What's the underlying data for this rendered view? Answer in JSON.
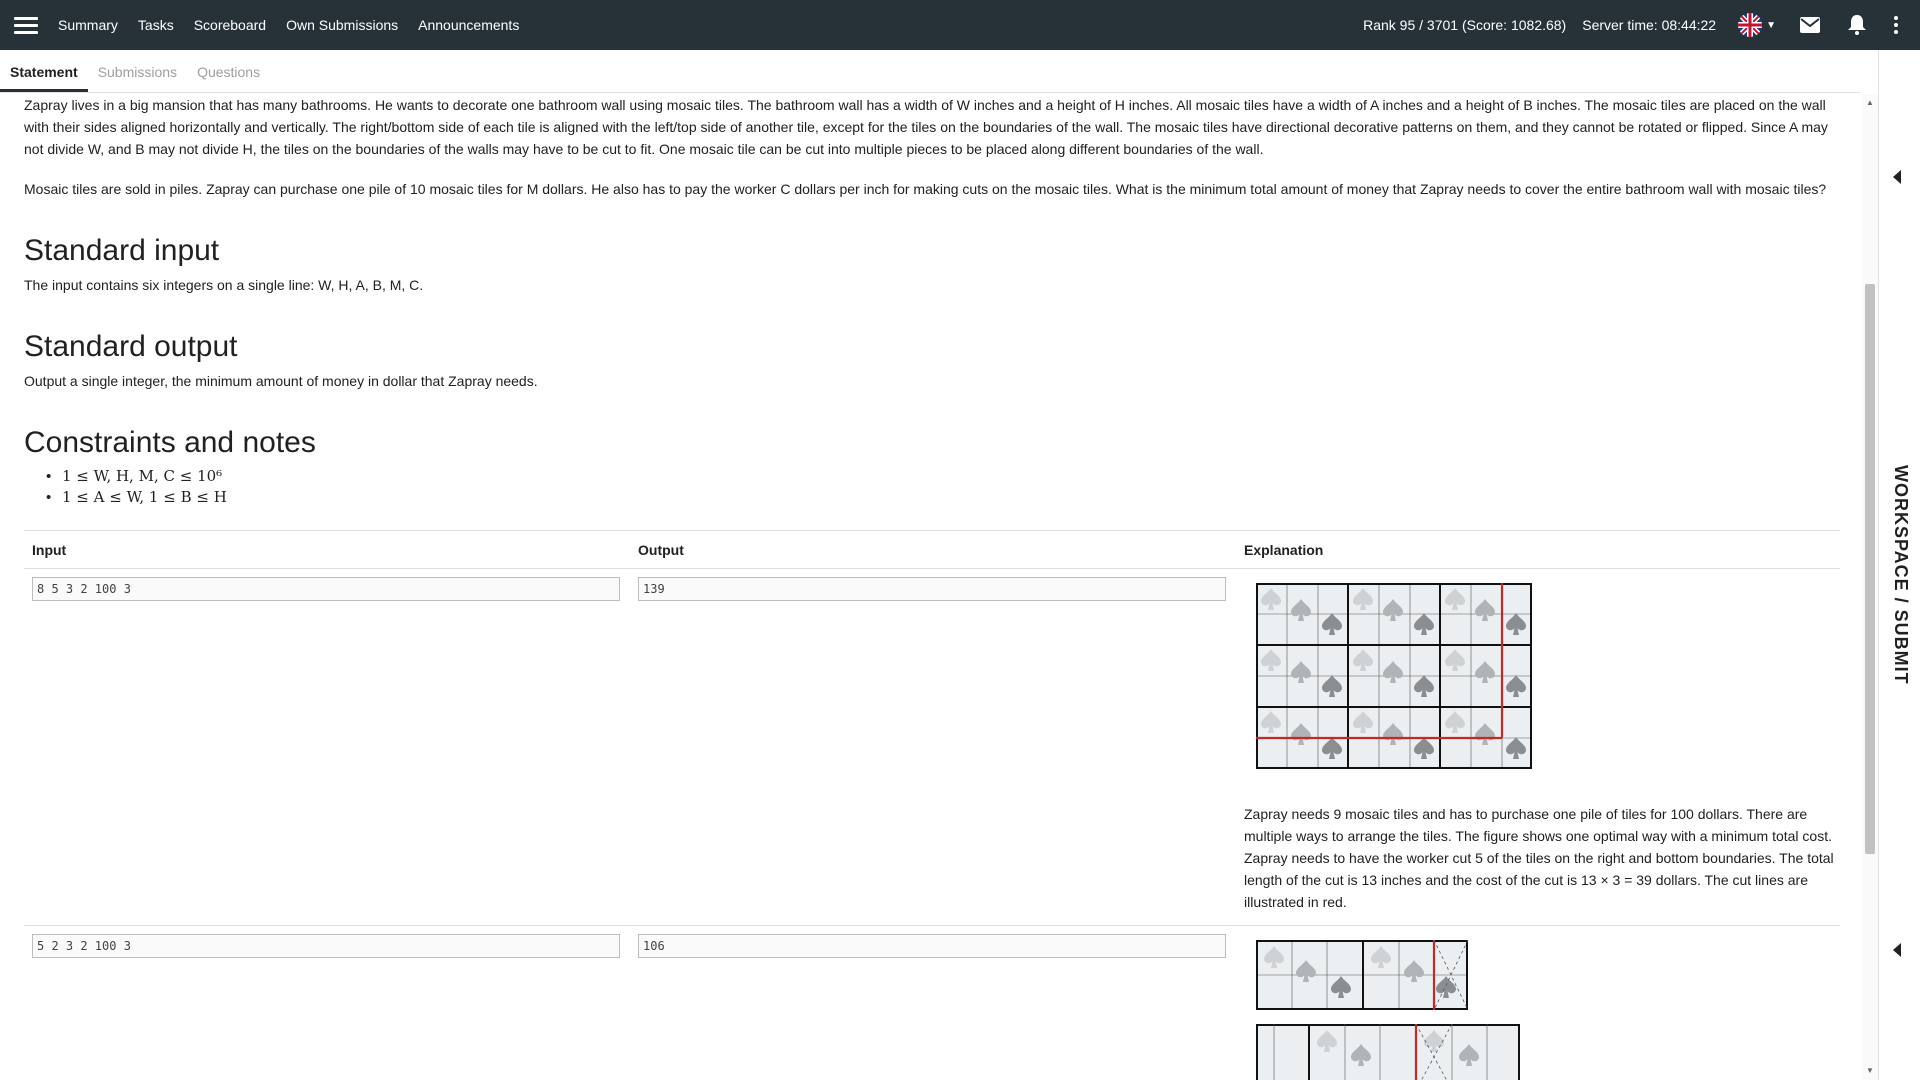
{
  "navbar": {
    "links": [
      "Summary",
      "Tasks",
      "Scoreboard",
      "Own Submissions",
      "Announcements"
    ],
    "rank": "Rank 95 / 3701 (Score: 1082.68)",
    "server_time": "Server time: 08:44:22",
    "icons": [
      "menu-icon",
      "uk-flag-icon",
      "envelope-icon",
      "bell-icon",
      "more-vert-icon"
    ]
  },
  "tabs": [
    "Statement",
    "Submissions",
    "Questions"
  ],
  "statement": {
    "intro": "Zapray lives in a big mansion that has many bathrooms. He wants to decorate one bathroom wall using mosaic tiles. The bathroom wall has a width of W inches and a height of H inches. All mosaic tiles have a width of A inches and a height of B inches. The mosaic tiles are placed on the wall with their sides aligned horizontally and vertically. The right/bottom side of each tile is aligned with the left/top side of another tile, except for the tiles on the boundaries of the wall. The mosaic tiles have directional decorative patterns on them, and they cannot be rotated or flipped. Since A may not divide W, and B may not divide H, the tiles on the boundaries of the walls may have to be cut to fit. One mosaic tile can be cut into multiple pieces to be placed along different boundaries of the wall.",
    "piles": "Mosaic tiles are sold in piles. Zapray can purchase one pile of 10 mosaic tiles for M dollars. He also has to pay the worker C dollars per inch for making cuts on the mosaic tiles. What is the minimum total amount of money that Zapray needs to cover the entire bathroom wall with mosaic tiles?",
    "input_heading": "Standard input",
    "input_text": "The input contains six integers on a single line: W, H, A, B, M, C.",
    "output_heading": "Standard output",
    "output_text": "Output a single integer, the minimum amount of money in dollar that Zapray needs.",
    "constraints_heading": "Constraints and notes",
    "constraints": [
      "1 ≤ W, H, M, C ≤ 10⁶",
      "1 ≤ A ≤ W, 1 ≤ B ≤ H"
    ]
  },
  "examples": {
    "headers": {
      "input": "Input",
      "output": "Output",
      "explanation": "Explanation"
    },
    "rows": [
      {
        "input": "8 5 3 2 100 3",
        "output": "139",
        "explanation": "Zapray needs 9 mosaic tiles and has to purchase one pile of tiles for 100 dollars. There are multiple ways to arrange the tiles. The figure shows one optimal way with a minimum total cost. Zapray needs to have the worker cut 5 of the tiles on the right and bottom boundaries. The total length of the cut is 13 inches and the cost of the cut is 13 × 3 = 39 dollars. The cut lines are illustrated in red."
      },
      {
        "input": "5 2 3 2 100 3",
        "output": "106",
        "explanation": ""
      }
    ]
  },
  "workspace": {
    "label": "WORKSPACE / SUBMIT"
  },
  "colors": {
    "navbar": "#263238",
    "cut_line": "#c62828",
    "tile_bg": "#eceff1"
  }
}
